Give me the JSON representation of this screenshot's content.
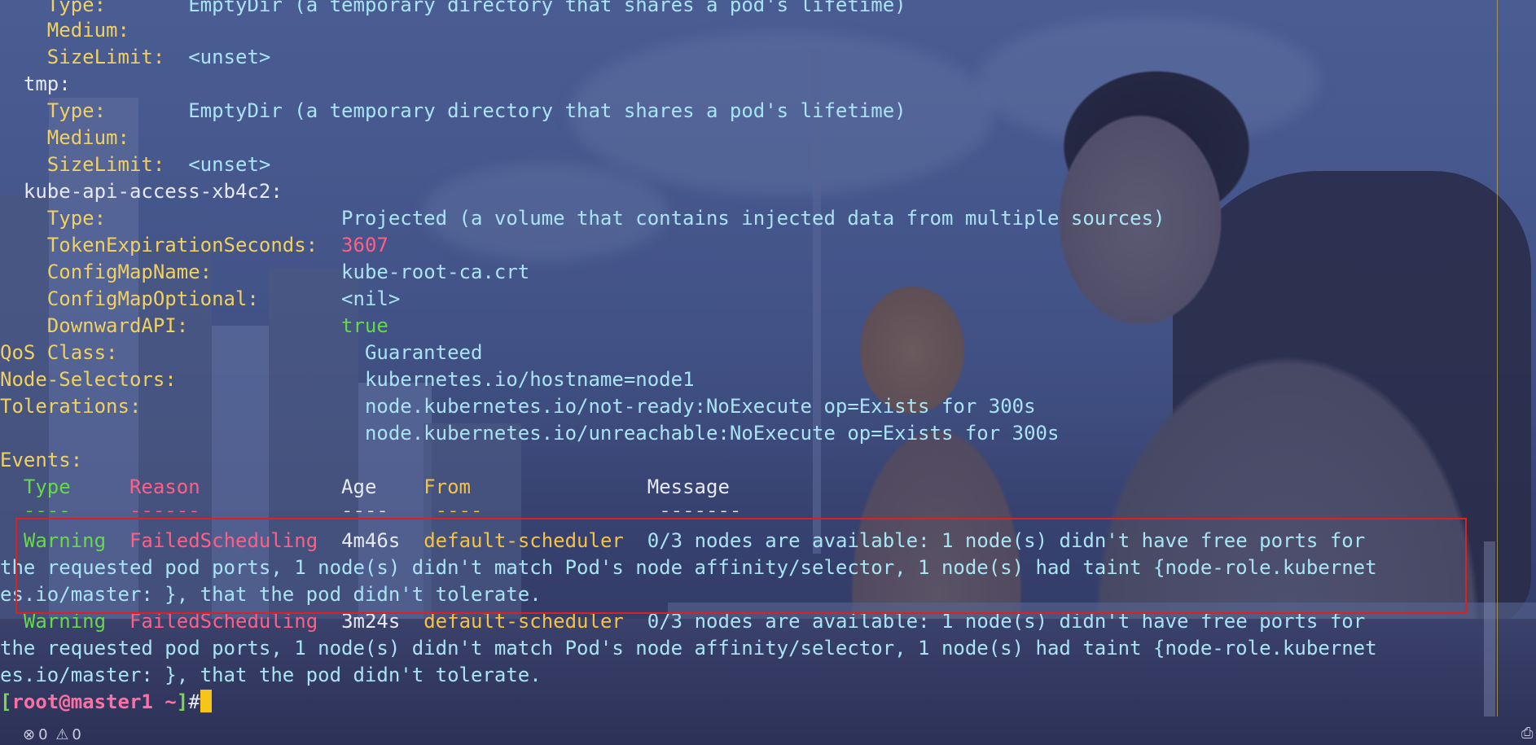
{
  "volumes": {
    "l0_type_key": "    Type:",
    "l0_type_val": "EmptyDir (a temporary directory that shares a pod's lifetime)",
    "l1_medium": "    Medium:",
    "l2_size_key": "    SizeLimit:",
    "l2_size_val": "<unset>",
    "tmp": "  tmp:",
    "l4_type_key": "    Type:",
    "l4_type_val": "EmptyDir (a temporary directory that shares a pod's lifetime)",
    "l5_medium": "    Medium:",
    "l6_size_key": "    SizeLimit:",
    "l6_size_val": "<unset>",
    "kube_api": "  kube-api-access-xb4c2:",
    "proj_type_key": "    Type:",
    "proj_type_val": "Projected (a volume that contains injected data from multiple sources)",
    "token_key": "    TokenExpirationSeconds:",
    "token_val": "3607",
    "cfg_name_key": "    ConfigMapName:",
    "cfg_name_val": "kube-root-ca.crt",
    "cfg_opt_key": "    ConfigMapOptional:",
    "cfg_opt_val": "<nil>",
    "downward_key": "    DownwardAPI:",
    "downward_val": "true"
  },
  "pod": {
    "qos_key": "QoS Class:",
    "qos_val": "Guaranteed",
    "node_sel_key": "Node-Selectors:",
    "node_sel_val": "kubernetes.io/hostname=node1",
    "tol_key": "Tolerations:",
    "tol_val1": "node.kubernetes.io/not-ready:NoExecute op=Exists for 300s",
    "tol_val2": "node.kubernetes.io/unreachable:NoExecute op=Exists for 300s",
    "events_key": "Events:"
  },
  "events": {
    "headers": {
      "type": "Type",
      "reason": "Reason",
      "age": "Age",
      "from": "From",
      "message": "Message"
    },
    "dashes": {
      "type": "----",
      "reason": "------",
      "age": "----",
      "from": "----",
      "message": "-------"
    },
    "rows": [
      {
        "type": "Warning",
        "reason": "FailedScheduling",
        "age": "4m46s",
        "from": "default-scheduler",
        "msg1": "0/3 nodes are available: 1 node(s) didn't have free ports for",
        "msg2": "the requested pod ports, 1 node(s) didn't match Pod's node affinity/selector, 1 node(s) had taint {node-role.kubernet",
        "msg3": "es.io/master: }, that the pod didn't tolerate."
      },
      {
        "type": "Warning",
        "reason": "FailedScheduling",
        "age": "3m24s",
        "from": "default-scheduler",
        "msg1": "0/3 nodes are available: 1 node(s) didn't have free ports for",
        "msg2": "the requested pod ports, 1 node(s) didn't match Pod's node affinity/selector, 1 node(s) had taint {node-role.kubernet",
        "msg3": "es.io/master: }, that the pod didn't tolerate."
      }
    ]
  },
  "prompt": {
    "open": "[",
    "user": "root",
    "at": "@",
    "host": "master1",
    "path": " ~",
    "close": "]",
    "hash": "#"
  },
  "status": {
    "errors": "0",
    "warnings": "0"
  },
  "colors": {
    "key_yellow": "#f0d060",
    "value_cyan": "#a8e4f4",
    "pink": "#ff5f87",
    "green": "#66d94a",
    "highlight_red": "#e02020"
  }
}
